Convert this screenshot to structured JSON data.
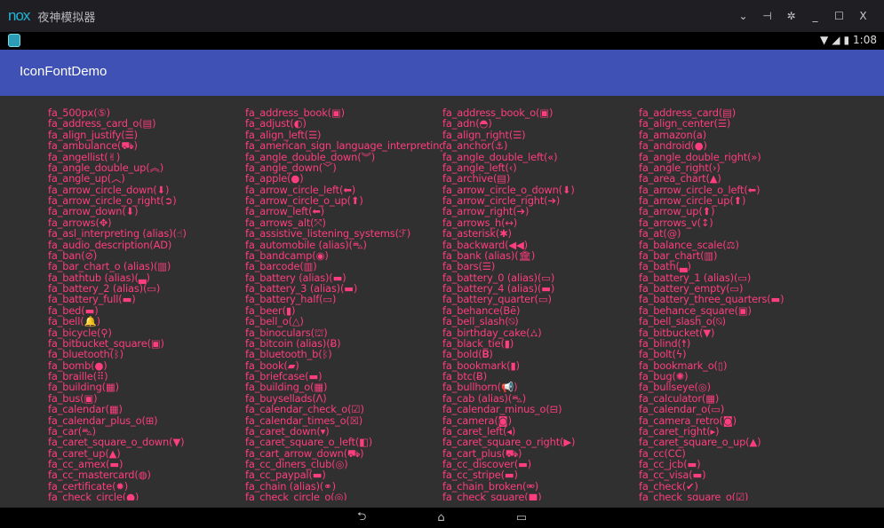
{
  "window": {
    "logo": "nox",
    "title": "夜神模拟器",
    "controls": [
      {
        "name": "dropdown",
        "glyph": "⌄"
      },
      {
        "name": "pin",
        "glyph": "⊣"
      },
      {
        "name": "settings",
        "glyph": "✲"
      },
      {
        "name": "minimize",
        "glyph": "_"
      },
      {
        "name": "maximize",
        "glyph": "☐"
      },
      {
        "name": "close",
        "glyph": "X"
      }
    ]
  },
  "status": {
    "time": "1:08",
    "wifi": "▼",
    "signal": "◢",
    "battery": "▮"
  },
  "app": {
    "title": "IconFontDemo"
  },
  "colors": {
    "text": "#ff3d7f",
    "appbar": "#3f51b5",
    "background": "#303030"
  },
  "columns": [
    [
      {
        "n": "fa_500px",
        "i": "⑤"
      },
      {
        "n": "fa_address_card_o",
        "i": "▤"
      },
      {
        "n": "fa_align_justify",
        "i": "☰"
      },
      {
        "n": "fa_ambulance",
        "i": "⛟"
      },
      {
        "n": "fa_angellist",
        "i": "✌"
      },
      {
        "n": "fa_angle_double_up",
        "i": "︽"
      },
      {
        "n": "fa_angle_up",
        "i": "︿"
      },
      {
        "n": "fa_arrow_circle_down",
        "i": "⬇"
      },
      {
        "n": "fa_arrow_circle_o_right",
        "i": "➲"
      },
      {
        "n": "fa_arrow_down",
        "i": "⬇"
      },
      {
        "n": "fa_arrows",
        "i": "✥"
      },
      {
        "n": "fa_asl_interpreting (alias)",
        "i": "☝"
      },
      {
        "n": "fa_audio_description",
        "i": "AD"
      },
      {
        "n": "fa_ban",
        "i": "⊘"
      },
      {
        "n": "fa_bar_chart_o (alias)",
        "i": "▥"
      },
      {
        "n": "fa_bathtub (alias)",
        "i": "▃"
      },
      {
        "n": "fa_battery_2 (alias)",
        "i": "▭"
      },
      {
        "n": "fa_battery_full",
        "i": "▬"
      },
      {
        "n": "fa_bed",
        "i": "▬"
      },
      {
        "n": "fa_bell",
        "i": "🔔"
      },
      {
        "n": "fa_bicycle",
        "i": "⚲"
      },
      {
        "n": "fa_bitbucket_square",
        "i": "▣"
      },
      {
        "n": "fa_bluetooth",
        "i": "ᛒ"
      },
      {
        "n": "fa_bomb",
        "i": "●"
      },
      {
        "n": "fa_braille",
        "i": "⠿"
      },
      {
        "n": "fa_building",
        "i": "▦"
      },
      {
        "n": "fa_bus",
        "i": "▣"
      },
      {
        "n": "fa_calendar",
        "i": "▦"
      },
      {
        "n": "fa_calendar_plus_o",
        "i": "⊞"
      },
      {
        "n": "fa_car",
        "i": "⛍"
      },
      {
        "n": "fa_caret_square_o_down",
        "i": "▼"
      },
      {
        "n": "fa_caret_up",
        "i": "▲"
      },
      {
        "n": "fa_cc_amex",
        "i": "▬"
      },
      {
        "n": "fa_cc_mastercard",
        "i": "◍"
      },
      {
        "n": "fa_certificate",
        "i": "✹"
      },
      {
        "n": "fa_check_circle",
        "i": "●"
      }
    ],
    [
      {
        "n": "fa_address_book",
        "i": "▣"
      },
      {
        "n": "fa_adjust",
        "i": "◐"
      },
      {
        "n": "fa_align_left",
        "i": "☰"
      },
      {
        "n": "fa_american_sign_language_interpreting",
        "i": "☝"
      },
      {
        "n": "fa_angle_double_down",
        "i": "︾"
      },
      {
        "n": "fa_angle_down",
        "i": "﹀"
      },
      {
        "n": "fa_apple",
        "i": "●"
      },
      {
        "n": "fa_arrow_circle_left",
        "i": "⬅"
      },
      {
        "n": "fa_arrow_circle_o_up",
        "i": "⬆"
      },
      {
        "n": "fa_arrow_left",
        "i": "⬅"
      },
      {
        "n": "fa_arrows_alt",
        "i": "⤧"
      },
      {
        "n": "fa_assistive_listening_systems",
        "i": "ℱ"
      },
      {
        "n": "fa_automobile (alias)",
        "i": "⛍"
      },
      {
        "n": "fa_bandcamp",
        "i": "◉"
      },
      {
        "n": "fa_barcode",
        "i": "▥"
      },
      {
        "n": "fa_battery (alias)",
        "i": "▬"
      },
      {
        "n": "fa_battery_3 (alias)",
        "i": "▬"
      },
      {
        "n": "fa_battery_half",
        "i": "▭"
      },
      {
        "n": "fa_beer",
        "i": "▮"
      },
      {
        "n": "fa_bell_o",
        "i": "△"
      },
      {
        "n": "fa_binoculars",
        "i": "⛫"
      },
      {
        "n": "fa_bitcoin (alias)",
        "i": "Ƀ"
      },
      {
        "n": "fa_bluetooth_b",
        "i": "ᛒ"
      },
      {
        "n": "fa_book",
        "i": "▰"
      },
      {
        "n": "fa_briefcase",
        "i": "▬"
      },
      {
        "n": "fa_building_o",
        "i": "▦"
      },
      {
        "n": "fa_buysellads",
        "i": "Λ"
      },
      {
        "n": "fa_calendar_check_o",
        "i": "☑"
      },
      {
        "n": "fa_calendar_times_o",
        "i": "☒"
      },
      {
        "n": "fa_caret_down",
        "i": "▾"
      },
      {
        "n": "fa_caret_square_o_left",
        "i": "◧"
      },
      {
        "n": "fa_cart_arrow_down",
        "i": "⛟"
      },
      {
        "n": "fa_cc_diners_club",
        "i": "◎"
      },
      {
        "n": "fa_cc_paypal",
        "i": "▬"
      },
      {
        "n": "fa_chain (alias)",
        "i": "⚭"
      },
      {
        "n": "fa_check_circle_o",
        "i": "◎"
      }
    ],
    [
      {
        "n": "fa_address_book_o",
        "i": "▣"
      },
      {
        "n": "fa_adn",
        "i": "◓"
      },
      {
        "n": "fa_align_right",
        "i": "☰"
      },
      {
        "n": "fa_anchor",
        "i": "⚓"
      },
      {
        "n": "fa_angle_double_left",
        "i": "«"
      },
      {
        "n": "fa_angle_left",
        "i": "‹"
      },
      {
        "n": "fa_archive",
        "i": "▤"
      },
      {
        "n": "fa_arrow_circle_o_down",
        "i": "⬇"
      },
      {
        "n": "fa_arrow_circle_right",
        "i": "➔"
      },
      {
        "n": "fa_arrow_right",
        "i": "➔"
      },
      {
        "n": "fa_arrows_h",
        "i": "↔"
      },
      {
        "n": "fa_asterisk",
        "i": "✱"
      },
      {
        "n": "fa_backward",
        "i": "◀◀"
      },
      {
        "n": "fa_bank (alias)",
        "i": "🏛"
      },
      {
        "n": "fa_bars",
        "i": "☰"
      },
      {
        "n": "fa_battery_0 (alias)",
        "i": "▭"
      },
      {
        "n": "fa_battery_4 (alias)",
        "i": "▬"
      },
      {
        "n": "fa_battery_quarter",
        "i": "▭"
      },
      {
        "n": "fa_behance",
        "i": "Bē"
      },
      {
        "n": "fa_bell_slash",
        "i": "⍉"
      },
      {
        "n": "fa_birthday_cake",
        "i": "⛼"
      },
      {
        "n": "fa_black_tie",
        "i": "▮"
      },
      {
        "n": "fa_bold",
        "i": "𝐁"
      },
      {
        "n": "fa_bookmark",
        "i": "▮"
      },
      {
        "n": "fa_btc",
        "i": "Ƀ"
      },
      {
        "n": "fa_bullhorn",
        "i": "📢"
      },
      {
        "n": "fa_cab (alias)",
        "i": "⛍"
      },
      {
        "n": "fa_calendar_minus_o",
        "i": "⊟"
      },
      {
        "n": "fa_camera",
        "i": "◙"
      },
      {
        "n": "fa_caret_left",
        "i": "◂"
      },
      {
        "n": "fa_caret_square_o_right",
        "i": "▶"
      },
      {
        "n": "fa_cart_plus",
        "i": "⛟"
      },
      {
        "n": "fa_cc_discover",
        "i": "▬"
      },
      {
        "n": "fa_cc_stripe",
        "i": "▬"
      },
      {
        "n": "fa_chain_broken",
        "i": "⚮"
      },
      {
        "n": "fa_check_square",
        "i": "■"
      }
    ],
    [
      {
        "n": "fa_address_card",
        "i": "▤"
      },
      {
        "n": "fa_align_center",
        "i": "☰"
      },
      {
        "n": "fa_amazon",
        "i": "a"
      },
      {
        "n": "fa_android",
        "i": "●"
      },
      {
        "n": "fa_angle_double_right",
        "i": "»"
      },
      {
        "n": "fa_angle_right",
        "i": "›"
      },
      {
        "n": "fa_area_chart",
        "i": "▲"
      },
      {
        "n": "fa_arrow_circle_o_left",
        "i": "⬅"
      },
      {
        "n": "fa_arrow_circle_up",
        "i": "⬆"
      },
      {
        "n": "fa_arrow_up",
        "i": "⬆"
      },
      {
        "n": "fa_arrows_v",
        "i": "↕"
      },
      {
        "n": "fa_at",
        "i": "@"
      },
      {
        "n": "fa_balance_scale",
        "i": "⚖"
      },
      {
        "n": "fa_bar_chart",
        "i": "▥"
      },
      {
        "n": "fa_bath",
        "i": "▃"
      },
      {
        "n": "fa_battery_1 (alias)",
        "i": "▭"
      },
      {
        "n": "fa_battery_empty",
        "i": "▭"
      },
      {
        "n": "fa_battery_three_quarters",
        "i": "▬"
      },
      {
        "n": "fa_behance_square",
        "i": "▣"
      },
      {
        "n": "fa_bell_slash_o",
        "i": "⍉"
      },
      {
        "n": "fa_bitbucket",
        "i": "▼"
      },
      {
        "n": "fa_blind",
        "i": "☨"
      },
      {
        "n": "fa_bolt",
        "i": "ϟ"
      },
      {
        "n": "fa_bookmark_o",
        "i": "▯"
      },
      {
        "n": "fa_bug",
        "i": "✺"
      },
      {
        "n": "fa_bullseye",
        "i": "◎"
      },
      {
        "n": "fa_calculator",
        "i": "▦"
      },
      {
        "n": "fa_calendar_o",
        "i": "▭"
      },
      {
        "n": "fa_camera_retro",
        "i": "◙"
      },
      {
        "n": "fa_caret_right",
        "i": "▸"
      },
      {
        "n": "fa_caret_square_o_up",
        "i": "▲"
      },
      {
        "n": "fa_cc",
        "i": "CC"
      },
      {
        "n": "fa_cc_jcb",
        "i": "▬"
      },
      {
        "n": "fa_cc_visa",
        "i": "▬"
      },
      {
        "n": "fa_check",
        "i": "✔"
      },
      {
        "n": "fa_check_square_o",
        "i": "☑"
      }
    ]
  ],
  "nav": {
    "back": "⮌",
    "home": "⌂",
    "recents": "▭"
  }
}
